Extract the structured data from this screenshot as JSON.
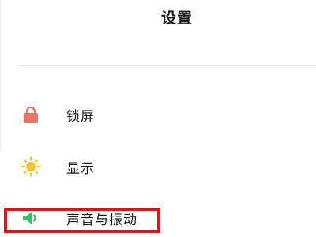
{
  "header": {
    "title": "设置"
  },
  "settings": {
    "items": [
      {
        "label": "锁屏",
        "icon": "lock-icon",
        "color": "#e8746a"
      },
      {
        "label": "显示",
        "icon": "sun-icon",
        "color": "#f6c22e"
      },
      {
        "label": "声音与振动",
        "icon": "speaker-icon",
        "color": "#3cbf6a"
      }
    ]
  },
  "highlight": {
    "color": "#e8101c"
  }
}
